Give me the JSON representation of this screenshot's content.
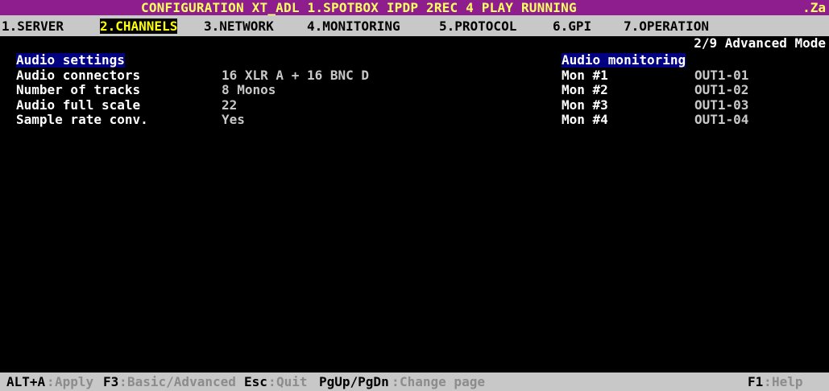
{
  "window": {
    "title": "CONFIGURATION XT_ADL 1.SPOTBOX IPDP 2REC 4 PLAY RUNNING",
    "corner_text": ".Za"
  },
  "tabs": [
    {
      "label": "1.SERVER",
      "active": false
    },
    {
      "label": "2.CHANNELS",
      "active": true
    },
    {
      "label": "3.NETWORK",
      "active": false
    },
    {
      "label": "4.MONITORING",
      "active": false
    },
    {
      "label": "5.PROTOCOL",
      "active": false
    },
    {
      "label": "6.GPI",
      "active": false
    },
    {
      "label": "7.OPERATION",
      "active": false
    }
  ],
  "page_indicator": "2/9 Advanced Mode",
  "audio_settings": {
    "heading": "Audio settings",
    "rows": [
      {
        "label": "Audio connectors",
        "value": "16 XLR A + 16 BNC D"
      },
      {
        "label": "Number of tracks",
        "value": "8 Monos"
      },
      {
        "label": "Audio full scale",
        "value": "22"
      },
      {
        "label": "Sample rate conv.",
        "value": "Yes"
      }
    ]
  },
  "audio_monitoring": {
    "heading": "Audio monitoring",
    "rows": [
      {
        "label": "Mon #1",
        "value": "OUT1-01"
      },
      {
        "label": "Mon #2",
        "value": "OUT1-02"
      },
      {
        "label": "Mon #3",
        "value": "OUT1-03"
      },
      {
        "label": "Mon #4",
        "value": "OUT1-04"
      }
    ]
  },
  "statusbar": {
    "apply_key": "ALT+A",
    "sep1": ":",
    "apply_label": "Apply",
    "mode_key": "F3",
    "sep2": ":",
    "mode_label": "Basic/Advanced",
    "quit_key": "Esc",
    "sep3": ":",
    "quit_label": "Quit",
    "page_key": "PgUp/PgDn",
    "sep4": ":",
    "page_label": "Change page",
    "help_key": "F1",
    "sep5": ":",
    "help_label": "Help"
  },
  "colors": {
    "title_bg": "#8e1e8e",
    "title_fg": "#ffff60",
    "tab_bar_bg": "#c8c8c8",
    "active_tab_fg": "#ffff00",
    "section_bg": "#000080",
    "screen_bg": "#000000"
  }
}
